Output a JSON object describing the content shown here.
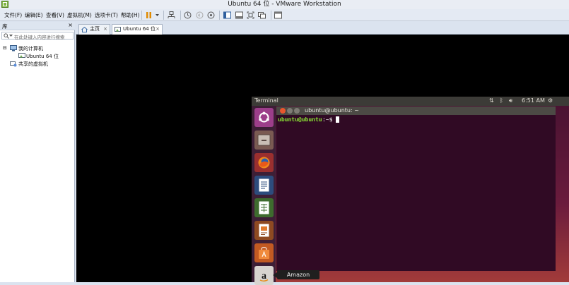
{
  "window": {
    "title": "Ubuntu 64 位 - VMware Workstation"
  },
  "menu": [
    "文件(F)",
    "编辑(E)",
    "查看(V)",
    "虚拟机(M)",
    "选项卡(T)",
    "帮助(H)"
  ],
  "library": {
    "title": "库",
    "close": "×",
    "search_placeholder": "在此处键入内容进行搜索",
    "tree": {
      "my_computer": "我的计算机",
      "vm": "Ubuntu 64 位",
      "shared": "共享的虚拟机"
    }
  },
  "tabs": [
    {
      "label": "主页",
      "close": "×"
    },
    {
      "label": "Ubuntu 64 位",
      "close": "×"
    }
  ],
  "ubuntu": {
    "panel_title": "Terminal",
    "clock": "6:51 AM",
    "terminal_title": "ubuntu@ubuntu: ~",
    "prompt": "ubuntu@ubuntu",
    "prompt_suffix": ":~$ ",
    "tooltip": "Amazon"
  },
  "colors": {
    "accent_orange": "#e95420",
    "terminal_bg": "#300a24",
    "prompt_green": "#8ae234"
  }
}
